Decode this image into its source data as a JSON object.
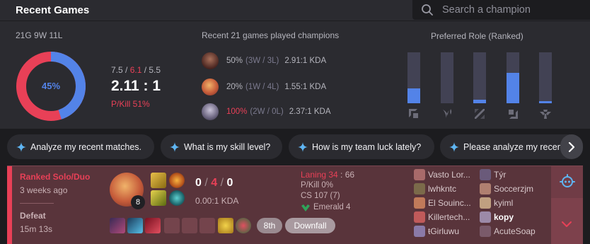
{
  "header": {
    "title": "Recent Games",
    "search_placeholder": "Search a champion"
  },
  "summary": {
    "record": "21G 9W 11L",
    "win_rate": "45%",
    "win_rate_value": 45,
    "kda_kills": "7.5",
    "kda_deaths": "6.1",
    "kda_assists": "5.5",
    "kda_ratio": "2.11 : 1",
    "pkill": "P/Kill 51%",
    "colors": {
      "win": "#5383e8",
      "loss": "#e84057"
    }
  },
  "champions": {
    "title": "Recent 21 games played champions",
    "items": [
      {
        "winrate": "50%",
        "wl": "(3W / 3L)",
        "kda": "2.91:1 KDA",
        "red": false
      },
      {
        "winrate": "20%",
        "wl": "(1W / 4L)",
        "kda": "1.55:1 KDA",
        "red": false
      },
      {
        "winrate": "100%",
        "wl": "(2W / 0L)",
        "kda": "2.37:1 KDA",
        "red": true
      }
    ]
  },
  "roles": {
    "title": "Preferred Role (Ranked)",
    "items": [
      {
        "icon": "top-role-icon",
        "value": 0.29
      },
      {
        "icon": "jungle-role-icon",
        "value": 0.0
      },
      {
        "icon": "mid-role-icon",
        "value": 0.07
      },
      {
        "icon": "adc-role-icon",
        "value": 0.6
      },
      {
        "icon": "support-role-icon",
        "value": 0.04
      }
    ]
  },
  "suggestions": [
    "Analyze my recent matches.",
    "What is my skill level?",
    "How is my team luck lately?",
    "Please analyze my recent"
  ],
  "match": {
    "queue": "Ranked Solo/Duo",
    "time_ago": "3 weeks ago",
    "result": "Defeat",
    "duration": "15m 13s",
    "level": "8",
    "kills": "0",
    "deaths": "4",
    "assists": "0",
    "kda": "0.00:1 KDA",
    "laning_label": "Laning 34",
    "laning_rest": " : 66",
    "pkill": "P/Kill 0%",
    "cs": "CS 107 (7)",
    "tier": "Emerald 4",
    "placement": "8th",
    "tag": "Downfall",
    "team_a": [
      "Vasto Lor...",
      "lwhkntc",
      "El Souinc...",
      "Killertech...",
      "ŧGirluwu"
    ],
    "team_b": [
      "Týr",
      "Soccerzjm",
      "kyiml",
      "kopy",
      "AcuteSoap"
    ],
    "me_index": 3
  }
}
